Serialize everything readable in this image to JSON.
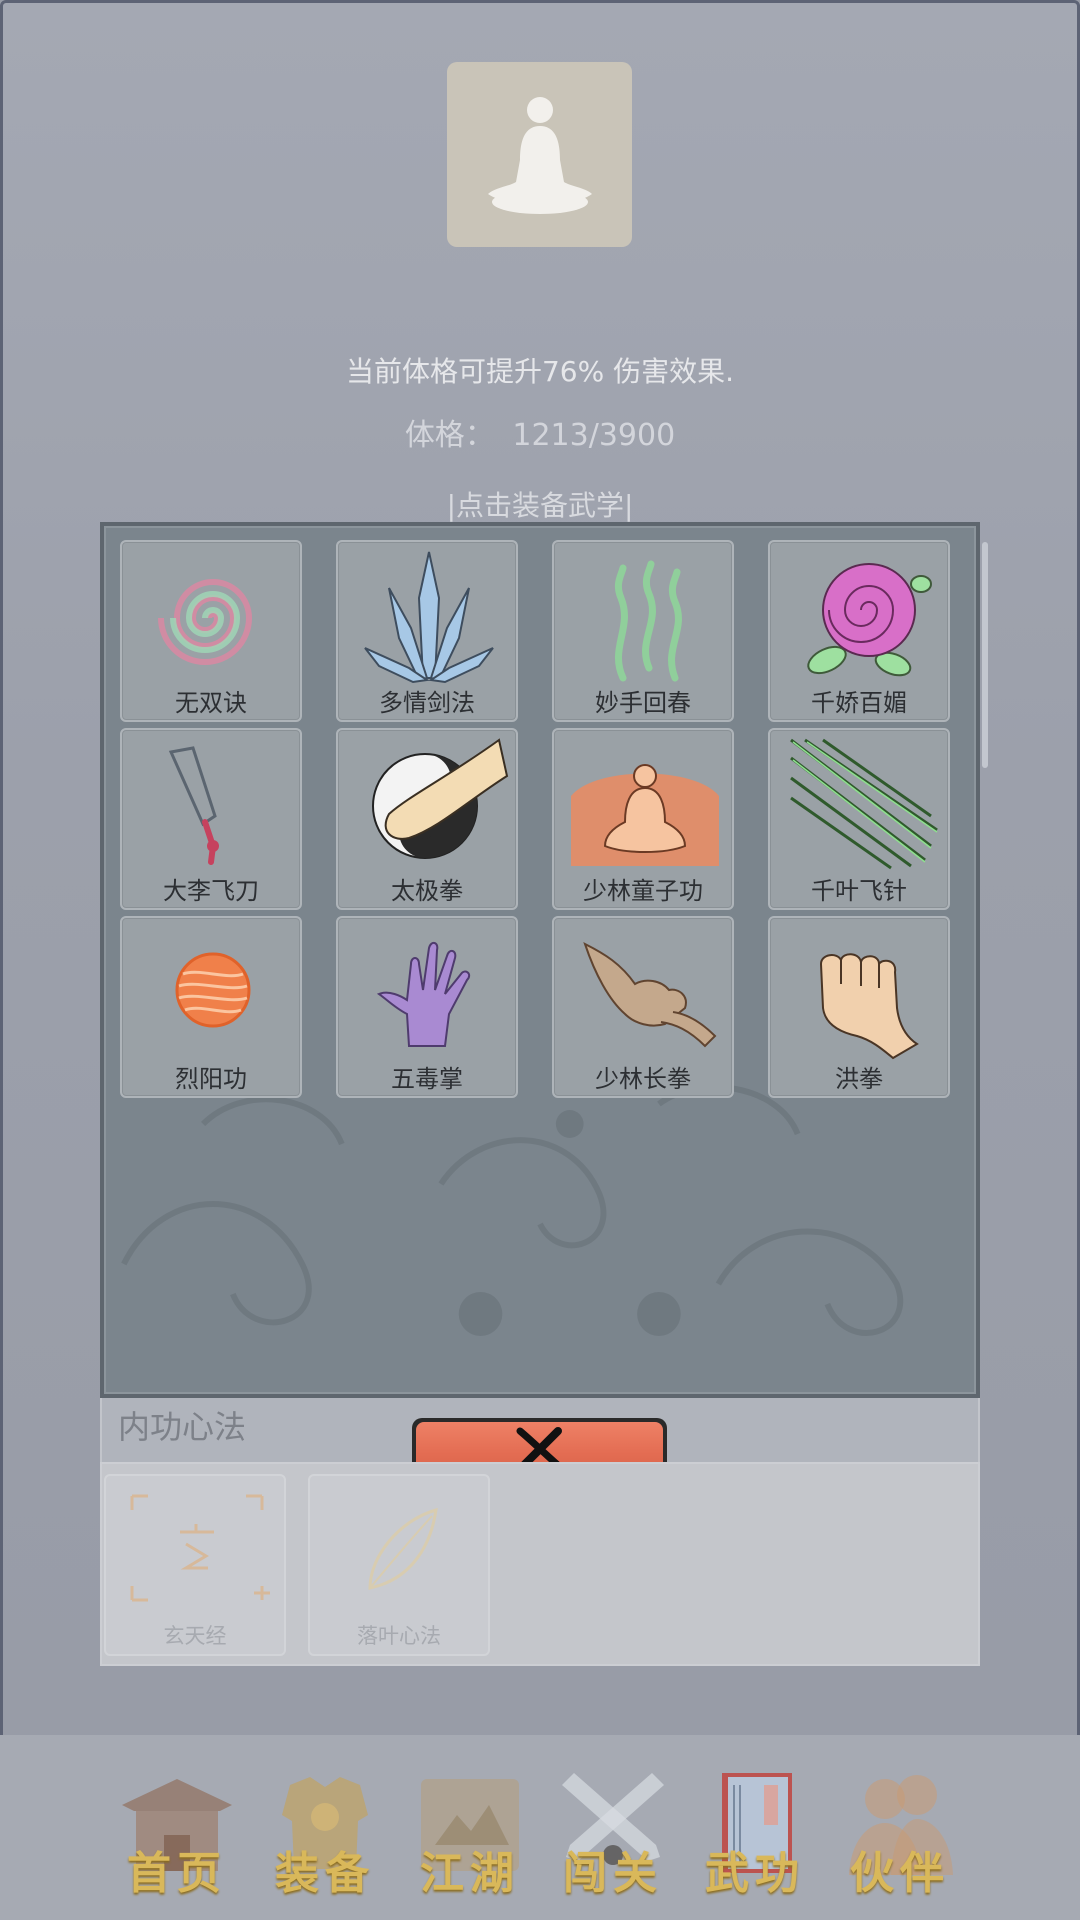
{
  "header": {
    "bonus_text": "当前体格可提升76% 伤害效果.",
    "stat_label": "体格：",
    "stat_value": "1213/3900",
    "hint": "|点击装备武学|"
  },
  "skills": [
    {
      "name": "无双诀",
      "icon": "spiral-icon"
    },
    {
      "name": "多情剑法",
      "icon": "crystal-blades-icon"
    },
    {
      "name": "妙手回春",
      "icon": "green-wisps-icon"
    },
    {
      "name": "千娇百媚",
      "icon": "rose-icon"
    },
    {
      "name": "大李飞刀",
      "icon": "flying-knife-icon"
    },
    {
      "name": "太极拳",
      "icon": "taiji-fist-icon"
    },
    {
      "name": "少林童子功",
      "icon": "meditating-monk-icon"
    },
    {
      "name": "千叶飞针",
      "icon": "flying-needles-icon"
    },
    {
      "name": "烈阳功",
      "icon": "fire-orb-icon"
    },
    {
      "name": "五毒掌",
      "icon": "poison-palm-icon"
    },
    {
      "name": "少林长拳",
      "icon": "long-fist-icon"
    },
    {
      "name": "洪拳",
      "icon": "fist-icon"
    }
  ],
  "neigong": {
    "title": "内功心法",
    "items": [
      {
        "name": "玄天经",
        "icon": "xuan-scroll-icon"
      },
      {
        "name": "落叶心法",
        "icon": "leaf-icon"
      }
    ]
  },
  "close_button": {
    "icon": "close-icon"
  },
  "nav": [
    {
      "label": "首页",
      "icon": "temple-icon"
    },
    {
      "label": "装备",
      "icon": "armor-icon"
    },
    {
      "label": "江湖",
      "icon": "map-scroll-icon"
    },
    {
      "label": "闯关",
      "icon": "crossed-swords-icon"
    },
    {
      "label": "武功",
      "icon": "martial-book-icon"
    },
    {
      "label": "伙伴",
      "icon": "companions-icon"
    }
  ],
  "colors": {
    "background": "#9a9ea9",
    "panel": "#7b858d",
    "close_button": "#e36c52",
    "nav_label": "#d9b85a"
  }
}
